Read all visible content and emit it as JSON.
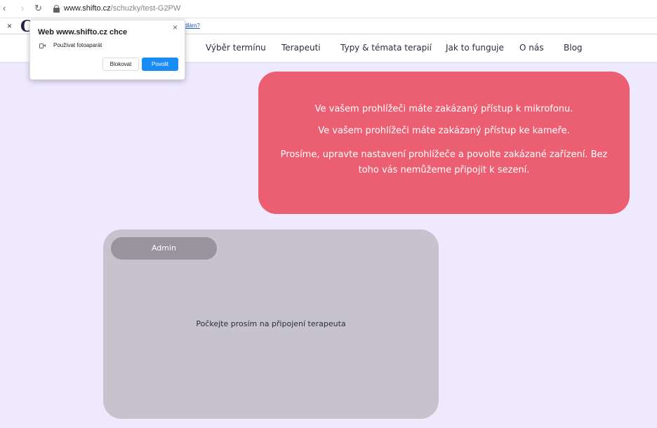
{
  "browser": {
    "url_host": "www.shifto.cz",
    "url_path": "/schuzky/test-G2PW",
    "back_icon": "chevron-left-icon",
    "forward_icon": "chevron-right-icon",
    "reload_icon": "reload-icon",
    "lock_icon": "lock-icon"
  },
  "infobar": {
    "close_label": "×",
    "logo_text": "C",
    "link_text": "dlám?"
  },
  "site_nav": {
    "items": [
      "Výběr termínu",
      "Terapeuti",
      "Typy & témata terapií",
      "Jak to funguje",
      "O nás",
      "Blog"
    ]
  },
  "permission_popup": {
    "title": "Web www.shifto.cz chce",
    "close_label": "×",
    "permission": "Používat fotoaparát",
    "permission_icon": "camera-icon",
    "block_label": "Blokovat",
    "allow_label": "Povolit",
    "allow_color": "#1a8cf5"
  },
  "alert": {
    "color": "#ec5f73",
    "messages": [
      "Ve vašem prohlížeči máte zakázaný přístup k mikrofonu.",
      "Ve vašem prohlížeči máte zakázaný přístup ke kameře.",
      "Prosíme, upravte nastavení prohlížeče a povolte zakázané zařízení. Bez toho vás nemůžeme připojit k sezení."
    ]
  },
  "video_tile": {
    "participant_label": "Admin",
    "waiting_text": "Počkejte prosím na připojení terapeuta"
  }
}
